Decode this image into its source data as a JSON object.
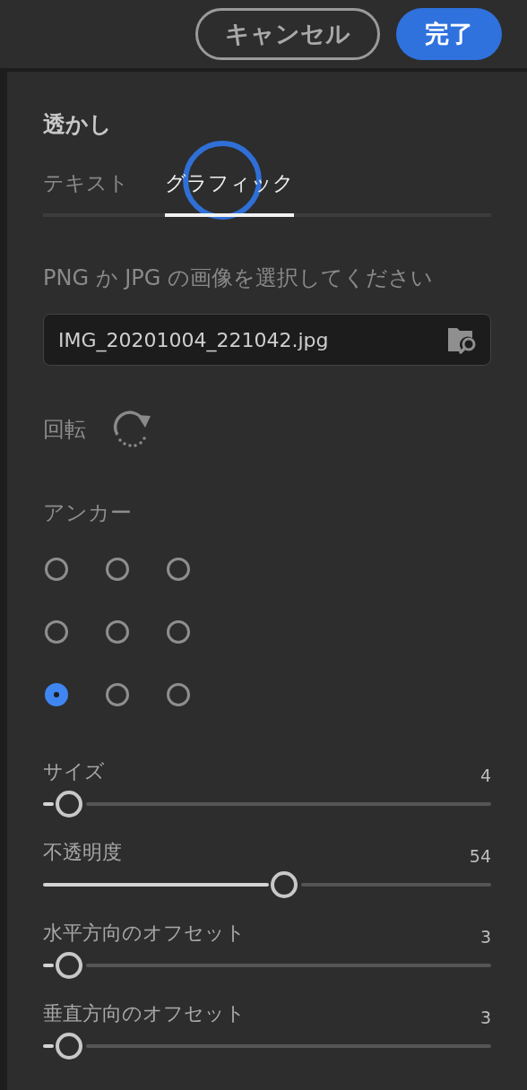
{
  "header": {
    "buttons": [
      {
        "label": "キャンセル",
        "kind": "secondary"
      },
      {
        "label": "完了",
        "kind": "primary"
      }
    ]
  },
  "panel": {
    "title": "透かし",
    "tabs": [
      {
        "label": "テキスト",
        "selected": false
      },
      {
        "label": "グラフィック",
        "selected": true
      }
    ],
    "prompt": "PNG か JPG の画像を選択してください",
    "file_field": {
      "value": "IMG_20201004_221042.jpg"
    },
    "rotation": {
      "label": "回転"
    },
    "anchor": {
      "label": "アンカー",
      "options": [
        {
          "selected": false
        },
        {
          "selected": false
        },
        {
          "selected": false
        },
        {
          "selected": false
        },
        {
          "selected": false
        },
        {
          "selected": false
        },
        {
          "selected": true
        },
        {
          "selected": false
        },
        {
          "selected": false
        }
      ]
    },
    "sliders": [
      {
        "label": "サイズ",
        "reading": "4",
        "level": 0.03
      },
      {
        "label": "不透明度",
        "reading": "54",
        "level": 0.54
      },
      {
        "label": "水平方向のオフセット",
        "reading": "3",
        "level": 0.03
      },
      {
        "label": "垂直方向のオフセット",
        "reading": "3",
        "level": 0.03
      }
    ]
  }
}
